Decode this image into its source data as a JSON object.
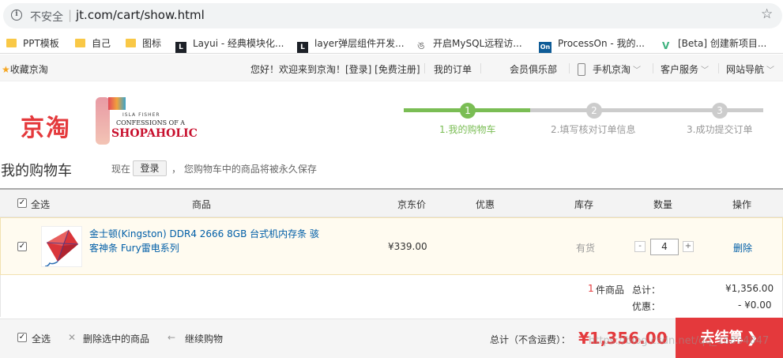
{
  "browser": {
    "security_label": "不安全",
    "url": "jt.com/cart/show.html",
    "bookmarks": [
      {
        "label": "PPT模板",
        "icon": "folder-icon"
      },
      {
        "label": "自己",
        "icon": "folder-icon"
      },
      {
        "label": "图标",
        "icon": "folder-icon"
      },
      {
        "label": "Layui - 经典模块化...",
        "icon": "layui-icon"
      },
      {
        "label": "layer弹层组件开发...",
        "icon": "layer-icon"
      },
      {
        "label": "开启MySQL远程访...",
        "icon": "mysql-icon"
      },
      {
        "label": "ProcessOn - 我的...",
        "icon": "processon-icon"
      },
      {
        "label": "[Beta] 创建新项目...",
        "icon": "vue-icon"
      }
    ]
  },
  "shortcut": {
    "favorite": "收藏京淘",
    "welcome": "您好！欢迎来到京淘！[登录] [免费注册]",
    "my_orders": "我的订单",
    "member_club": "会员俱乐部",
    "mobile": "手机京淘",
    "customer_service": "客户服务",
    "site_nav": "网站导航"
  },
  "header": {
    "logo": "京淘",
    "ad": {
      "line1": "ISLA FISHER",
      "line2": "CONFESSIONS OF A",
      "line3": "SHOPAHOLIC"
    }
  },
  "steps": [
    {
      "num": "1",
      "label": "1.我的购物车",
      "active": true
    },
    {
      "num": "2",
      "label": "2.填写核对订单信息",
      "active": false
    },
    {
      "num": "3",
      "label": "3.成功提交订单",
      "active": false
    }
  ],
  "colors": {
    "accent": "#e4393c",
    "step_active": "#7abd54",
    "step_inactive": "#cccccc",
    "link": "#005ea7"
  },
  "cart": {
    "title": "我的购物车",
    "login_prefix": "现在",
    "login_button": "登录",
    "save_tip": "，  您购物车中的商品将被永久保存",
    "columns": {
      "select_all": "全选",
      "product": "商品",
      "price": "京东价",
      "discount": "优惠",
      "stock": "库存",
      "quantity": "数量",
      "action": "操作"
    },
    "items": [
      {
        "name": "金士顿(Kingston) DDR4 2666 8GB 台式机内存条 骇客神条 Fury雷电系列",
        "price": "¥339.00",
        "stock": "有货",
        "quantity": "4",
        "delete": "删除",
        "checked": true
      }
    ],
    "summary": {
      "count": "1",
      "count_unit": "件商品",
      "total_label": "总计：",
      "total": "¥1,356.00",
      "discount_label": "优惠：",
      "discount": "- ¥0.00"
    },
    "bottom": {
      "select_all": "全选",
      "delete_selected": "删除选中的商品",
      "continue": "继续购物",
      "total_label": "总计（不含运费）：",
      "total": "¥1,356.00",
      "checkout": "去结算"
    }
  },
  "watermark": "https://blog.csdn.net/qq_16804847"
}
